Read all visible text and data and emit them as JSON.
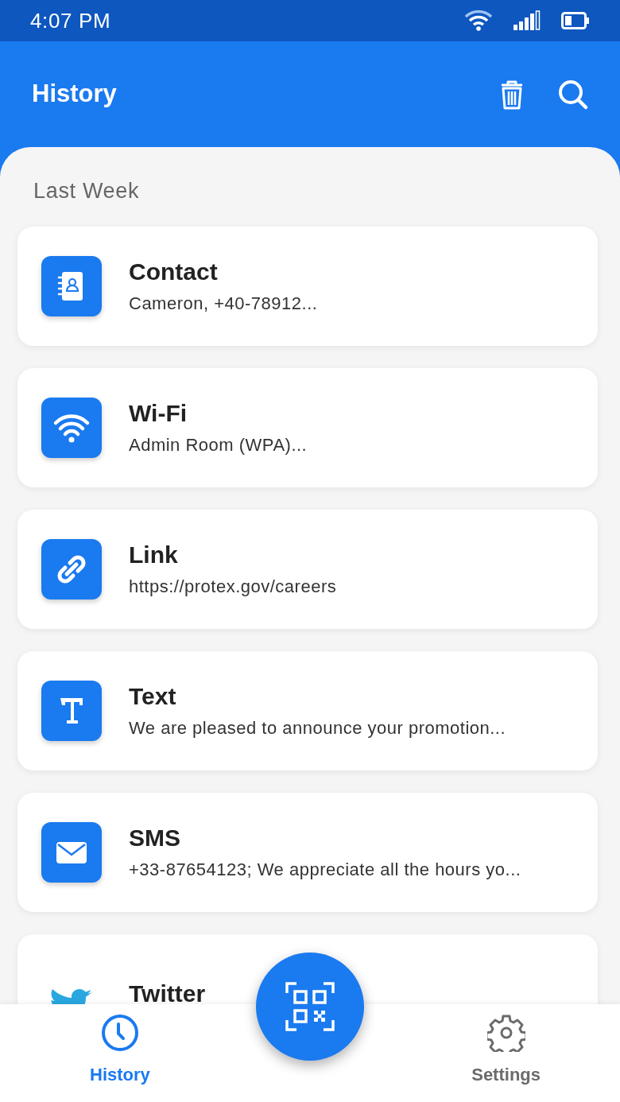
{
  "status_bar": {
    "time": "4:07 PM"
  },
  "header": {
    "title": "History"
  },
  "section": {
    "label": "Last Week"
  },
  "items": [
    {
      "kind": "contact",
      "title": "Contact",
      "subtitle": "Cameron, +40-78912..."
    },
    {
      "kind": "wifi",
      "title": "Wi-Fi",
      "subtitle": "Admin Room (WPA)..."
    },
    {
      "kind": "link",
      "title": "Link",
      "subtitle": "https://protex.gov/careers"
    },
    {
      "kind": "text",
      "title": "Text",
      "subtitle": "We are pleased to announce your promotion..."
    },
    {
      "kind": "sms",
      "title": "SMS",
      "subtitle": "+33-87654123; We appreciate all the hours yo..."
    },
    {
      "kind": "twitter",
      "title": "Twitter"
    }
  ],
  "nav": [
    {
      "kind": "history",
      "label": "History",
      "selected": true
    },
    {
      "kind": "settings",
      "label": "Settings",
      "selected": false
    }
  ]
}
